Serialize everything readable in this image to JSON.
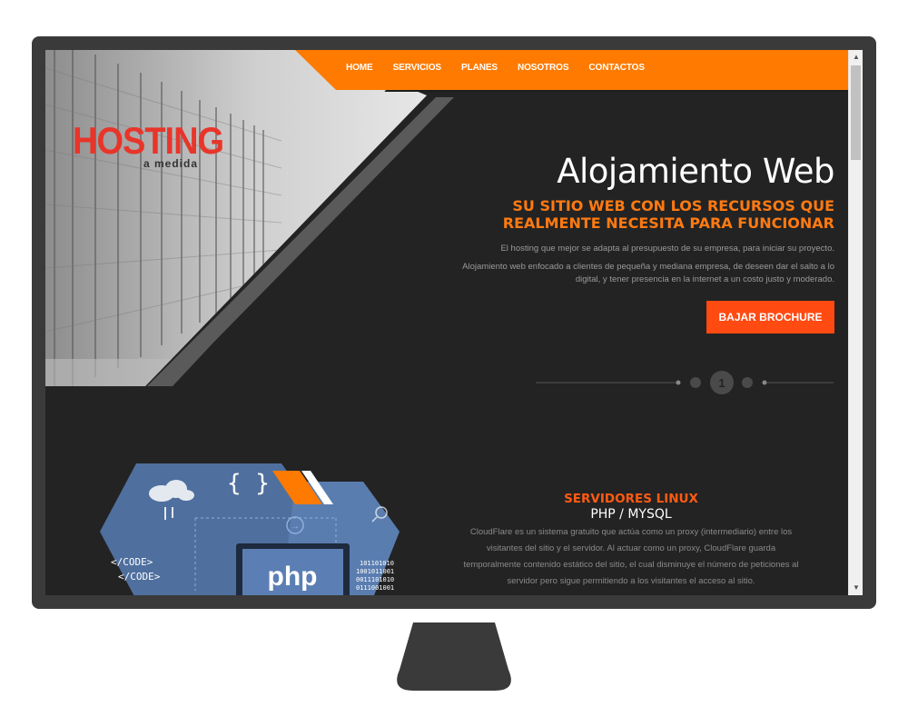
{
  "nav": {
    "items": [
      "HOME",
      "SERVICIOS",
      "PLANES",
      "NOSOTROS",
      "CONTACTOS"
    ]
  },
  "logo": {
    "main": "HOSTING",
    "sub": "a medida"
  },
  "hero": {
    "title": "Alojamiento Web",
    "subtitle_line1": "SU SITIO WEB CON LOS RECURSOS QUE",
    "subtitle_line2": "REALMENTE NECESITA PARA FUNCIONAR",
    "paragraph1": "El hosting que mejor se adapta al presupuesto de su empresa, para iniciar su proyecto.",
    "paragraph2": "Alojamiento web enfocado a clientes de pequeña y mediana empresa, de deseen dar el salto a lo digital, y tener presencia en la internet a un costo justo y moderado.",
    "button_label": "BAJAR BROCHURE"
  },
  "slider": {
    "current_page": "1"
  },
  "services": {
    "title": "SERVIDORES LINUX",
    "subtitle": "PHP / MYSQL",
    "body": "CloudFlare es un sistema gratuito que actúa como un proxy (intermediario) entre los visitantes del sitio y el servidor. Al actuar como un proxy, CloudFlare guarda temporalmente contenido estático del sitio, el cual disminuye el número de peticiones al servidor pero sigue permitiendo a los visitantes el acceso al sitio."
  },
  "art": {
    "php_label": "php",
    "code_line1": "</CODE>",
    "code_line2": "</CODE>",
    "binary1": "101101010",
    "binary2": "1001011001",
    "binary3": "0011101010",
    "binary4": "0111001001",
    "braces": "{ }"
  },
  "colors": {
    "accent_orange": "#ff7a00",
    "button_orange": "#ff4a12",
    "logo_red": "#e8352a",
    "dark_bg": "#232323",
    "monitor_frame": "#3a3a3a"
  }
}
